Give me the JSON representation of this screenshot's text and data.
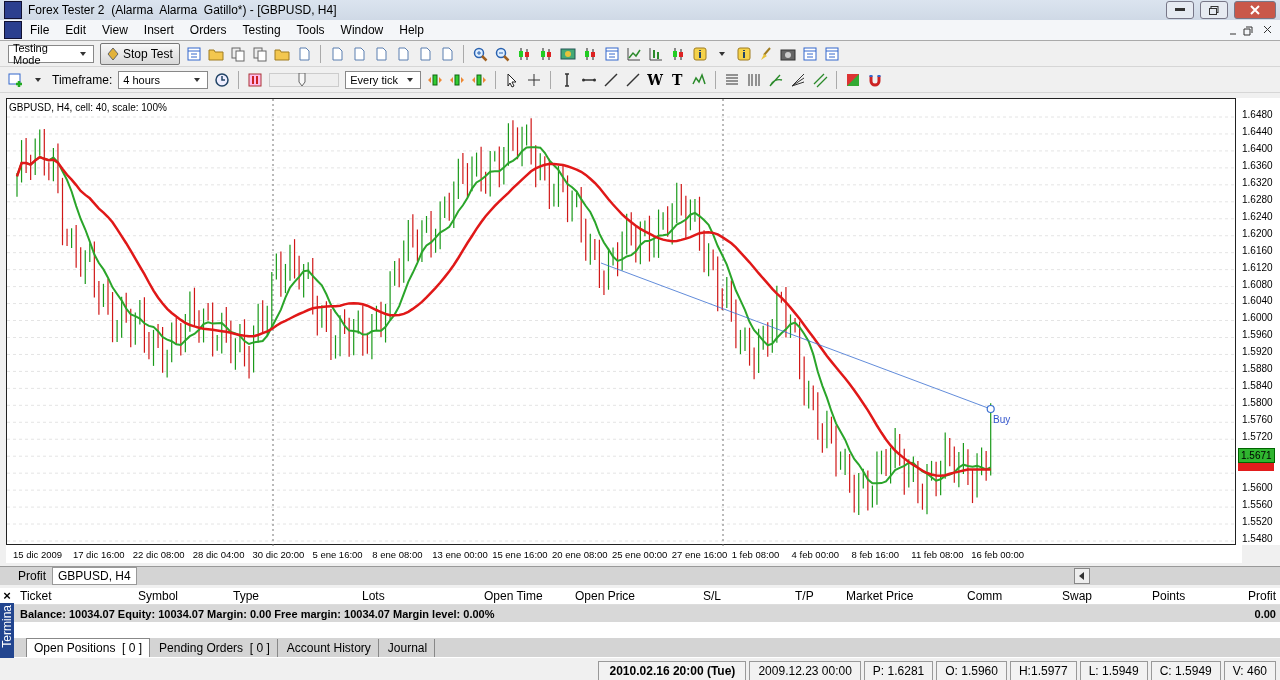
{
  "window": {
    "title": "Forex Tester 2  (Alarma  Alarma  Gatillo*) - [GBPUSD, H4]"
  },
  "menu": [
    "File",
    "Edit",
    "View",
    "Insert",
    "Orders",
    "Testing",
    "Tools",
    "Window",
    "Help"
  ],
  "toolbar": {
    "mode": "Testing Mode",
    "stop_button": "Stop Test",
    "timeframe_label": "Timeframe:",
    "timeframe": "4 hours",
    "tick_mode": "Every tick",
    "speed": {
      "level": 0.45
    },
    "text_tools": [
      "W",
      "T"
    ]
  },
  "chart": {
    "info": "GBPUSD, H4, cell: 40, scale: 100%",
    "order_label": "Buy",
    "price_axis": [
      {
        "kind": "label",
        "text": "1.6480"
      },
      {
        "kind": "label",
        "text": "1.6440"
      },
      {
        "kind": "label",
        "text": "1.6400"
      },
      {
        "kind": "label",
        "text": "1.6360"
      },
      {
        "kind": "label",
        "text": "1.6320"
      },
      {
        "kind": "label",
        "text": "1.6280"
      },
      {
        "kind": "label",
        "text": "1.6240"
      },
      {
        "kind": "label",
        "text": "1.6200"
      },
      {
        "kind": "label",
        "text": "1.6160"
      },
      {
        "kind": "label",
        "text": "1.6120"
      },
      {
        "kind": "label",
        "text": "1.6080"
      },
      {
        "kind": "label",
        "text": "1.6040"
      },
      {
        "kind": "label",
        "text": "1.6000"
      },
      {
        "kind": "label",
        "text": "1.5960"
      },
      {
        "kind": "label",
        "text": "1.5920"
      },
      {
        "kind": "label",
        "text": "1.5880"
      },
      {
        "kind": "label",
        "text": "1.5840"
      },
      {
        "kind": "label",
        "text": "1.5800"
      },
      {
        "kind": "label",
        "text": "1.5760"
      },
      {
        "kind": "label",
        "text": "1.5720"
      },
      {
        "kind": "tag",
        "text": "1.5671"
      },
      {
        "kind": "marker"
      },
      {
        "kind": "label",
        "text": "1.5600"
      },
      {
        "kind": "label",
        "text": "1.5560"
      },
      {
        "kind": "label",
        "text": "1.5520"
      },
      {
        "kind": "label",
        "text": "1.5480"
      }
    ],
    "time_labels": [
      "15 dic 2009",
      "17 dic 16:00",
      "22 dic 08:00",
      "28 dic 04:00",
      "30 dic 20:00",
      "5 ene 16:00",
      "8 ene 08:00",
      "13 ene 00:00",
      "15 ene 16:00",
      "20 ene 08:00",
      "25 ene 00:00",
      "27 ene 16:00",
      "1 feb 08:00",
      "4 feb 00:00",
      "8 feb 16:00",
      "11 feb 08:00",
      "16 feb 00:00"
    ]
  },
  "chart_tabs": [
    {
      "label": "Profit",
      "selected": false
    },
    {
      "label": "GBPUSD, H4",
      "selected": true
    }
  ],
  "terminal": {
    "close_glyph": "×",
    "side_label": "Termina",
    "columns": [
      "Ticket",
      "Symbol",
      "Type",
      "Lots",
      "Open Time",
      "Open Price",
      "S/L",
      "T/P",
      "Market Price",
      "Comm",
      "Swap",
      "Points",
      "Profit"
    ],
    "balance": "Balance: 10034.07 Equity: 10034.07 Margin: 0.00 Free margin: 10034.07 Margin level: 0.00%",
    "profit_total": "0.00",
    "tabs": [
      {
        "label": "Open Positions  [ 0 ]",
        "selected": true
      },
      {
        "label": "Pending Orders  [ 0 ]",
        "selected": false
      },
      {
        "label": "Account History",
        "selected": false
      },
      {
        "label": "Journal",
        "selected": false
      }
    ]
  },
  "status_bar": [
    "2010.02.16 20:00 (Tue)",
    "2009.12.23 00:00",
    "P: 1.6281",
    "O: 1.5960",
    "H:1.5977",
    "L: 1.5949",
    "C: 1.5949",
    "V: 460"
  ]
}
